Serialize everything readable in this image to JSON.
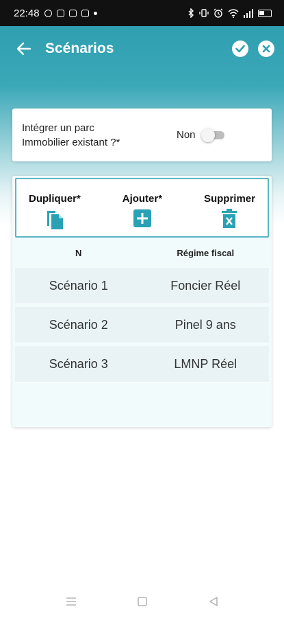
{
  "status_bar": {
    "time": "22:48",
    "left_icons": [
      "pinterest-icon",
      "youtube-icon",
      "instagram-icon",
      "flipboard-icon"
    ],
    "right_icons": [
      "bluetooth-icon",
      "vibrate-icon",
      "alarm-icon",
      "wifi-icon",
      "signal-icon",
      "battery-icon"
    ]
  },
  "app_bar": {
    "title": "Scénarios",
    "back_icon": "arrow-left-icon",
    "actions": [
      "check-icon",
      "close-icon"
    ]
  },
  "parc": {
    "question": "Intégrer un parc\nImmobilier existant ?*",
    "value": "Non",
    "toggle_on": false
  },
  "toolbar": {
    "duplicate_label": "Dupliquer*",
    "add_label": "Ajouter*",
    "delete_label": "Supprimer"
  },
  "table": {
    "headers": [
      "N",
      "Régime fiscal"
    ],
    "rows": [
      [
        "Scénario 1",
        "Foncier Réel"
      ],
      [
        "Scénario 2",
        "Pinel 9 ans"
      ],
      [
        "Scénario 3",
        "LMNP Réel"
      ]
    ]
  },
  "colors": {
    "header_teal": "#2f9fb0",
    "accent": "#2aa1b5",
    "toolbar_border": "#5bb5c2",
    "row_bg": "#e9f3f5"
  }
}
